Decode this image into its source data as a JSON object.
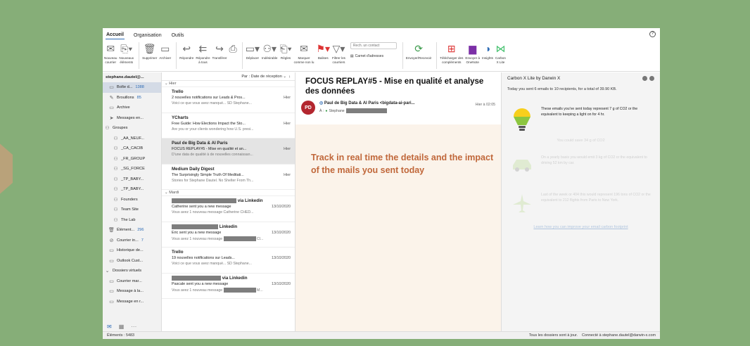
{
  "ribbon": {
    "tabs": [
      "Accueil",
      "Organisation",
      "Outils"
    ],
    "buttons": [
      {
        "label": "Nouveau\ncourrier",
        "icon": "envelope-icon"
      },
      {
        "label": "Nouveaux\néléments",
        "icon": "new-items-icon"
      },
      {
        "label": "Supprimer",
        "icon": "trash-icon"
      },
      {
        "label": "Archiver",
        "icon": "archive-icon"
      },
      {
        "label": "Répondre",
        "icon": "reply-icon"
      },
      {
        "label": "Répondre\nà tous",
        "icon": "reply-all-icon"
      },
      {
        "label": "Transférer",
        "icon": "forward-icon"
      },
      {
        "label": "",
        "icon": "attachment-icon"
      },
      {
        "label": "Déplacer",
        "icon": "move-icon"
      },
      {
        "label": "Indésirable",
        "icon": "junk-icon"
      },
      {
        "label": "Règles",
        "icon": "rules-icon"
      },
      {
        "label": "Marquer\ncomme non lu",
        "icon": "read-icon"
      },
      {
        "label": "Balises",
        "icon": "flag-icon"
      },
      {
        "label": "Filtrer les\ncourriers",
        "icon": "filter-icon"
      }
    ],
    "search_placeholder": "Rech. un contact",
    "address_book": "Carnet d'adresses",
    "send_receive": "Envoyer/Recevoir",
    "addins": [
      {
        "label": "Télécharger des\ncompléments",
        "icon": "addin-icon"
      },
      {
        "label": "Envoyer à\nOneNote",
        "icon": "onenote-icon"
      },
      {
        "label": "Insights",
        "icon": "insights-icon"
      },
      {
        "label": "Carbon\nX Lite",
        "icon": "carbon-icon"
      }
    ]
  },
  "folders": {
    "account": "stephane.dautel@...",
    "items": [
      {
        "label": "Boîte d... ",
        "count": "1388",
        "icon": "inbox-icon",
        "indent": 8,
        "selected": true
      },
      {
        "label": "Brouillons",
        "count": "85",
        "icon": "drafts-icon",
        "indent": 8
      },
      {
        "label": "Archive",
        "count": "",
        "icon": "archive-icon",
        "indent": 8
      },
      {
        "label": "Messages en...",
        "count": "",
        "icon": "outbox-icon",
        "indent": 8
      },
      {
        "label": "Groupes",
        "count": "",
        "icon": "groups-icon",
        "indent": 2
      },
      {
        "label": "_AA_NEUF...",
        "count": "",
        "icon": "group-icon",
        "indent": 14
      },
      {
        "label": "_CA_CACIB",
        "count": "",
        "icon": "group-icon",
        "indent": 14
      },
      {
        "label": "_FR_GROUP",
        "count": "",
        "icon": "group-icon",
        "indent": 14
      },
      {
        "label": "_SG_FORCE",
        "count": "",
        "icon": "group-icon",
        "indent": 14
      },
      {
        "label": "_TP_BABY...",
        "count": "",
        "icon": "group-icon",
        "indent": 14
      },
      {
        "label": "_TP_BABY...",
        "count": "",
        "icon": "group-icon",
        "indent": 14
      },
      {
        "label": "Founders",
        "count": "",
        "icon": "group-icon",
        "indent": 14
      },
      {
        "label": "Team Site",
        "count": "",
        "icon": "group-icon",
        "indent": 14
      },
      {
        "label": "The Lab",
        "count": "",
        "icon": "group-icon",
        "indent": 14
      },
      {
        "label": "Élément...",
        "count": "296",
        "icon": "deleted-icon",
        "indent": 8
      },
      {
        "label": "Courrier in...",
        "count": "7",
        "icon": "junk-folder-icon",
        "indent": 8
      },
      {
        "label": "Historique de...",
        "count": "",
        "icon": "folder-icon",
        "indent": 8
      },
      {
        "label": "Outlook Cust...",
        "count": "",
        "icon": "folder-icon",
        "indent": 8
      },
      {
        "label": "Dossiers virtuels",
        "count": "",
        "icon": "virtual-icon",
        "indent": 2
      },
      {
        "label": "Courrier mar...",
        "count": "",
        "icon": "folder-icon",
        "indent": 8
      },
      {
        "label": "Message à la...",
        "count": "",
        "icon": "folder-icon",
        "indent": 8
      },
      {
        "label": "Message en r...",
        "count": "",
        "icon": "folder-icon",
        "indent": 8
      }
    ]
  },
  "list": {
    "sort_label": "Par : Date de réception",
    "messages": [
      {
        "group": "Hier"
      },
      {
        "sender": "Trello",
        "subject": "2 nouvelles notifications sur Leads & Pros...",
        "date": "Hier",
        "preview": "Voici ce que vous avez manqué... SD Stephane..."
      },
      {
        "sender": "YCharts",
        "subject": "Free Guide: How Elections Impact the Sto...",
        "date": "Hier",
        "preview": "Are you or your clients wondering how U.S. presi..."
      },
      {
        "sender": "Paul de Big Data & AI Paris",
        "subject": "FOCUS REPLAY#5 - Mise en qualité et an...",
        "date": "Hier",
        "preview": "D'une data de qualité à de nouvelles connaissan...",
        "selected": true
      },
      {
        "sender": "Medium Daily Digest",
        "subject": "The Surprisingly Simple Truth Of Meditati...",
        "date": "Hier",
        "preview": "Stories for Stephane Dautel. No Shelter From Th..."
      },
      {
        "group": "Mardi"
      },
      {
        "sender": "via Linkedin",
        "redact": 92,
        "subject": "Catherine sent you a new message",
        "date": "13/10/2020",
        "preview": "Vous avez 1 nouveau message Catherine CHED..."
      },
      {
        "sender": "Linkedin",
        "redact": 66,
        "subject": "Eric sent you a new message",
        "date": "13/10/2020",
        "preview": "Vous avez 1 nouveau message",
        "preview_redact": 46,
        "preview_tail": "Cl..."
      },
      {
        "sender": "Trello",
        "subject": "19 nouvelles notifications sur Leads...",
        "date": "13/10/2020",
        "preview": "Voici ce que vous avez manqué... SD Stephane..."
      },
      {
        "sender": "via Linkedin",
        "redact": 70,
        "subject": "Pascale sent you a new message",
        "date": "13/10/2020",
        "preview": "Vous avez 1 nouveau message",
        "preview_redact": 46,
        "preview_tail": "M..."
      }
    ]
  },
  "reading": {
    "title": "FOCUS REPLAY#5 - Mise en qualité et analyse des données",
    "avatar": "PD",
    "from": "Paul de Big Data & AI Paris <bigdata-ai-pari...",
    "to_label": "À :",
    "to_name": "Stephane",
    "date": "Hier à 02:05",
    "promo": "Track in real time the details and the impact of the mails you sent today"
  },
  "side": {
    "title": "Carbon X Lite  by Darwin X",
    "summary": "Today you sent 6 emails to 10 recipients, for a total of 39.90 KB.",
    "panel1": "These emails you've sent today represent 7 g of CO2 or the equivalent to keeping a light on for 4 hr.",
    "faded1": "You could save 34 g of CO2",
    "panel2": "On a yearly basis you would emit 3 kg of CO2 or the equivalent to driving 52 km by car.",
    "panel3": "Last of the week or 404 this would represent 196 tons of CO2 or the equivalent to 212 flights from Paris to New York.",
    "link": "Learn how you can improve your email carbon footprint"
  },
  "status": {
    "left": "Éléments : 5483",
    "right": "Tous les dossiers sont à jour.    Connecté à stephane.dautel@darwin-x.com"
  },
  "colors": {
    "accent": "#2d6bb5",
    "promo_text": "#c0673a",
    "avatar_bg": "#b3262f",
    "background": "#86ae78"
  }
}
